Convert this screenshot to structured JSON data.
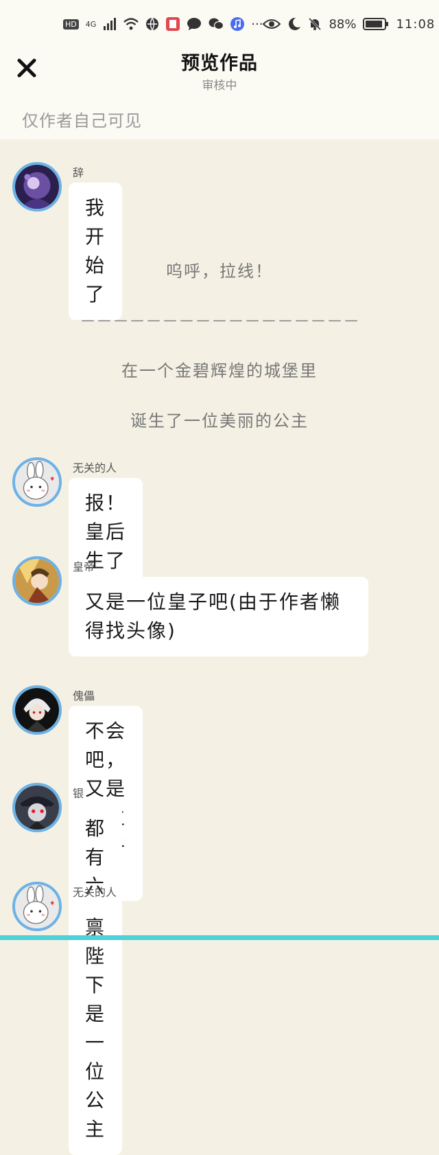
{
  "statusbar": {
    "network": "4G",
    "battery": "88%",
    "time": "11:08",
    "hd": "HD",
    "more": "···"
  },
  "header": {
    "title": "预览作品",
    "subtitle": "审核中",
    "visibility_note": "仅作者自己可见"
  },
  "messages": [
    {
      "name": "辞",
      "text": "我开始了",
      "avatar": "purple-avatar"
    },
    {
      "name": "无关的人",
      "text": "报！皇后生了",
      "avatar": "bunny-avatar"
    },
    {
      "name": "皇帝",
      "text": "又是一位皇子吧(由于作者懒得找头像)",
      "avatar": "anime-avatar"
    },
    {
      "name": "傀儡",
      "text": "不会吧，又是一位皇子啊",
      "avatar": "white-hair-avatar"
    },
    {
      "name": "银",
      "text": "都有六个了",
      "avatar": "red-eye-avatar"
    },
    {
      "name": "无关的人",
      "text": "禀陛下是一位公主",
      "avatar": "bunny-avatar"
    }
  ],
  "narration": [
    "呜呼，拉线！",
    "－－－－－－－－－－－－－－－－－",
    "在一个金碧辉煌的城堡里",
    "诞生了一位美丽的公主"
  ]
}
